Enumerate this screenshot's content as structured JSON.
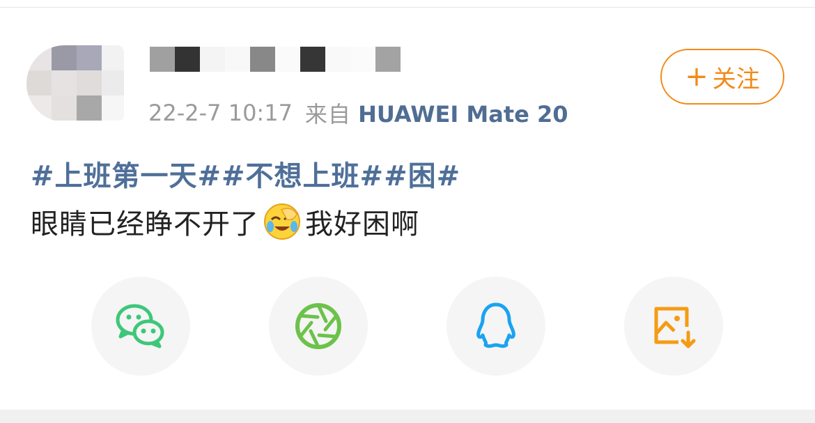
{
  "post": {
    "timestamp": "22-2-7 10:17",
    "from_label": "来自",
    "device": "HUAWEI Mate 20",
    "follow_label": "关注",
    "follow_plus": "+",
    "topics": [
      "#上班第一天#",
      "#不想上班#",
      "#困#"
    ],
    "text_before_emoji": "眼睛已经睁不开了",
    "emoji": "facepalm-cry-emoji",
    "text_after_emoji": "我好困啊"
  },
  "share": {
    "items": [
      {
        "name": "wechat",
        "icon": "wechat-icon",
        "color": "#3dc779"
      },
      {
        "name": "moments",
        "icon": "moments-shutter-icon",
        "color": "#6cc24a"
      },
      {
        "name": "qq",
        "icon": "qq-penguin-icon",
        "color": "#1aa3f0"
      },
      {
        "name": "save-image",
        "icon": "save-image-icon",
        "color": "#f59b14"
      }
    ]
  },
  "colors": {
    "accent_orange": "#f38a17",
    "link_blue": "#4f6f99",
    "meta_gray": "#9a9a9a",
    "share_bg": "#f5f5f5"
  }
}
